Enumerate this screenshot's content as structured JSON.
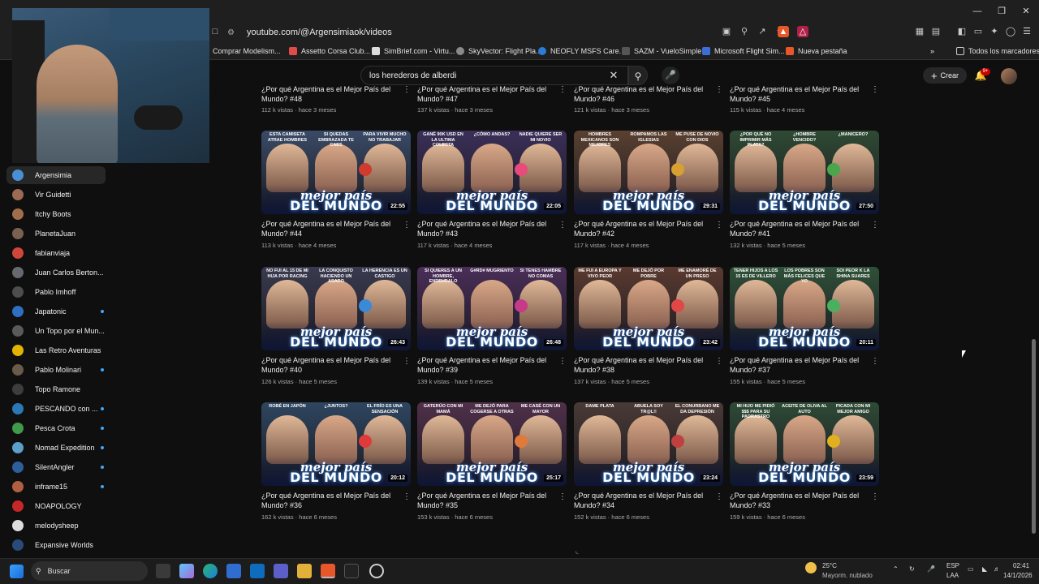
{
  "browser": {
    "url": "youtube.com/@Argensimiaok/videos",
    "bookmarks": [
      {
        "label": "Comprar Modelism...",
        "color": "#c9a227"
      },
      {
        "label": "Assetto Corsa Club...",
        "color": "#e24a4a"
      },
      {
        "label": "SimBrief.com - Virtu...",
        "color": "#dddddd"
      },
      {
        "label": "SkyVector: Flight Pla...",
        "color": "#8a8a8a"
      },
      {
        "label": "NEOFLY MSFS Care...",
        "color": "#2b7bd8"
      },
      {
        "label": "SAZM - VueloSimple",
        "color": "#555555"
      },
      {
        "label": "Microsoft Flight Sim...",
        "color": "#3a6fd6"
      },
      {
        "label": "Nueva pestaña",
        "color": "#e8572a"
      }
    ],
    "all_bookmarks_label": "Todos los marcadores"
  },
  "header": {
    "search_value": "los herederos de alberdi",
    "create_label": "Crear",
    "notification_badge": "9+"
  },
  "sidebar": {
    "items": [
      {
        "label": "Argensimia",
        "color": "#4a8fd6",
        "active": true,
        "dot": false
      },
      {
        "label": "Vir Guidetti",
        "color": "#9b6a52",
        "active": false,
        "dot": false
      },
      {
        "label": "Itchy Boots",
        "color": "#a06e4a",
        "active": false,
        "dot": false
      },
      {
        "label": "PlanetaJuan",
        "color": "#7a6050",
        "active": false,
        "dot": false
      },
      {
        "label": "fabianviaja",
        "color": "#d0463a",
        "active": false,
        "dot": false
      },
      {
        "label": "Juan Carlos Berton...",
        "color": "#666a70",
        "active": false,
        "dot": false
      },
      {
        "label": "Pablo Imhoff",
        "color": "#4d4d4d",
        "active": false,
        "dot": false
      },
      {
        "label": "Japatonic",
        "color": "#2e6fc2",
        "active": false,
        "dot": true
      },
      {
        "label": "Un Topo por el Mun...",
        "color": "#5a5a5a",
        "active": false,
        "dot": false
      },
      {
        "label": "Las Retro Aventuras",
        "color": "#e2b400",
        "active": false,
        "dot": false
      },
      {
        "label": "Pablo Molinari",
        "color": "#6a5a4a",
        "active": false,
        "dot": true
      },
      {
        "label": "Topo Ramone",
        "color": "#3d3d3d",
        "active": false,
        "dot": false
      },
      {
        "label": "PESCANDO con ...",
        "color": "#2a78b8",
        "active": false,
        "dot": true
      },
      {
        "label": "Pesca Crota",
        "color": "#3f9a4a",
        "active": false,
        "dot": true
      },
      {
        "label": "Nomad Expedition",
        "color": "#5aa0c8",
        "active": false,
        "dot": true
      },
      {
        "label": "SilentAngler",
        "color": "#2d5f9a",
        "active": false,
        "dot": true
      },
      {
        "label": "inframe15",
        "color": "#b06040",
        "active": false,
        "dot": true
      },
      {
        "label": "NOAPOLOGY",
        "color": "#c62828",
        "active": false,
        "dot": false
      },
      {
        "label": "melodysheep",
        "color": "#ddd",
        "active": false,
        "dot": false
      },
      {
        "label": "Expansive Worlds",
        "color": "#2a4a7a",
        "active": false,
        "dot": false
      }
    ]
  },
  "videos": {
    "top_partial": [
      {
        "title": "¿Por qué Argentina es el Mejor País del Mundo? #48",
        "meta": "112 k vistas · hace 3 meses"
      },
      {
        "title": "¿Por qué Argentina es el Mejor País del Mundo? #47",
        "meta": "137 k vistas · hace 3 meses"
      },
      {
        "title": "¿Por qué Argentina es el Mejor País del Mundo? #46",
        "meta": "121 k vistas · hace 3 meses"
      },
      {
        "title": "¿Por qué Argentina es el Mejor País del Mundo? #45",
        "meta": "115 k vistas · hace 4 meses"
      }
    ],
    "overlay_line1": "mejor país",
    "overlay_line2": "DEL MUNDO",
    "rows": [
      [
        {
          "title": "¿Por qué Argentina es el Mejor País del Mundo? #44",
          "meta": "113 k vistas · hace 4 meses",
          "duration": "22:55",
          "captions": [
            "ESTA CAMISETA ATRAE HOMBRES",
            "SI QUEDAS EMBRAZADA TE CAES",
            "PARA VIVIR MUCHO NO TRABAJAR"
          ],
          "bg": "#3a4a66",
          "accent": "#cf3b2f"
        },
        {
          "title": "¿Por qué Argentina es el Mejor País del Mundo? #43",
          "meta": "117 k vistas · hace 4 meses",
          "duration": "22:05",
          "captions": [
            "GANÉ 90K USD EN LA ULTIMA COLECTA",
            "¿CÓMO ANDAS?",
            "NADIE QUIERE SER MI NOVIO"
          ],
          "bg": "#3b2f58",
          "accent": "#e84a7a"
        },
        {
          "title": "¿Por qué Argentina es el Mejor País del Mundo? #42",
          "meta": "117 k vistas · hace 4 meses",
          "duration": "29:31",
          "captions": [
            "HOMBRES MEXICANOS SON MEJORES",
            "ROMPAMOS LAS IGLESIAS",
            "ME PUSE DE NOVIO CON DIOS"
          ],
          "bg": "#5a4030",
          "accent": "#d8a030"
        },
        {
          "title": "¿Por qué Argentina es el Mejor País del Mundo? #41",
          "meta": "132 k vistas · hace 5 meses",
          "duration": "27:50",
          "captions": [
            "¿POR QUÉ NO IMPRIMIR MÁS PLATA?",
            "¿HOMBRE VENCIDO?",
            "¿MANICERO?"
          ],
          "bg": "#2f4a34",
          "accent": "#49a64a"
        }
      ],
      [
        {
          "title": "¿Por qué Argentina es el Mejor País del Mundo? #40",
          "meta": "126 k vistas · hace 5 meses",
          "duration": "26:43",
          "captions": [
            "NO FUI AL 15 DE MI HIJA POR RACING",
            "LA CONQUISTO HACIENDO UN ASADO",
            "LA HERENCIA ES UN CASTIGO"
          ],
          "bg": "#3a3a50",
          "accent": "#3a8ad8"
        },
        {
          "title": "¿Por qué Argentina es el Mejor País del Mundo? #39",
          "meta": "139 k vistas · hace 5 meses",
          "duration": "26:48",
          "captions": [
            "SI QUIERES A UN HOMBRE, ENDEUDALO",
            "G#RD# MUGRIENTO",
            "SI TENES HAMBRE NO COMAS"
          ],
          "bg": "#4a2e58",
          "accent": "#c63a8a"
        },
        {
          "title": "¿Por qué Argentina es el Mejor País del Mundo? #38",
          "meta": "137 k vistas · hace 5 meses",
          "duration": "23:42",
          "captions": [
            "ME FUI A EUROPA Y VIVO PEOR",
            "ME DEJÓ POR POBRE",
            "ME ENAMORÉ DE UN PRESO"
          ],
          "bg": "#5a3a30",
          "accent": "#e04848"
        },
        {
          "title": "¿Por qué Argentina es el Mejor País del Mundo? #37",
          "meta": "155 k vistas · hace 5 meses",
          "duration": "20:11",
          "captions": [
            "TENER HIJOS A LOS 15 ES DE VILLERO",
            "LOS POBRES SON MÁS FELICES QUE YO",
            "SOI PEOR K LA SHINA SUARES"
          ],
          "bg": "#2f5038",
          "accent": "#4ab060"
        }
      ],
      [
        {
          "title": "¿Por qué Argentina es el Mejor País del Mundo? #36",
          "meta": "162 k vistas · hace 6 meses",
          "duration": "20:12",
          "captions": [
            "ROBÉ EN JAPÓN",
            "¿JUNTOS?",
            "EL FRÍO ES UNA SENSACIÓN"
          ],
          "bg": "#2e4660",
          "accent": "#e03a3a"
        },
        {
          "title": "¿Por qué Argentina es el Mejor País del Mundo? #35",
          "meta": "153 k vistas · hace 6 meses",
          "duration": "25:17",
          "captions": [
            "GATERÚO CON MI MAMÁ",
            "ME DEJÓ PARA COGERSE A OTRAS",
            "ME CASÉ CON UN MAYOR"
          ],
          "bg": "#50304a",
          "accent": "#e07a3a"
        },
        {
          "title": "¿Por qué Argentina es el Mejor País del Mundo? #34",
          "meta": "152 k vistas · hace 6 meses",
          "duration": "23:24",
          "captions": [
            "DAME PLATA",
            "ABUELA SOY TR@L!!",
            "EL CONURBANO ME DA DEPRESIÓN"
          ],
          "bg": "#4a3a36",
          "accent": "#c04040"
        },
        {
          "title": "¿Por qué Argentina es el Mejor País del Mundo? #33",
          "meta": "159 k vistas · hace 6 meses",
          "duration": "23:59",
          "captions": [
            "MI HIJO ME PIDIÓ $$$ PARA SU PADRASTRO",
            "ACEITE DE OLIVA AL AUTO",
            "PICADA CON MI MEJOR AMIGO"
          ],
          "bg": "#2e4a36",
          "accent": "#e0b020"
        }
      ]
    ]
  },
  "taskbar": {
    "search_label": "Buscar",
    "weather_temp": "25°C",
    "weather_desc": "Mayorm. nublado",
    "lang_line1": "ESP",
    "lang_line2": "LAA",
    "time": "02:41",
    "date": "14/1/2026"
  }
}
